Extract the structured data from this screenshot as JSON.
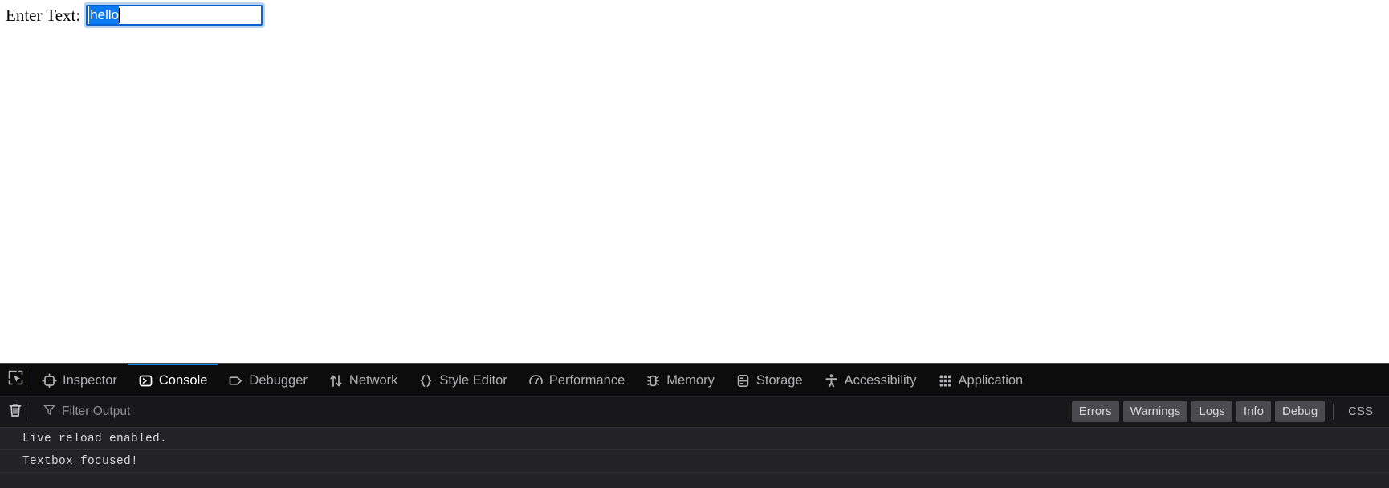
{
  "page": {
    "field_label": "Enter Text:",
    "input_value": "hello",
    "input_placeholder": "",
    "selection_color": "#0a7bf5",
    "focus_ring_color": "#0a62d0"
  },
  "devtools": {
    "accent_color": "#0a84ff",
    "picker_icon": "element-picker-icon",
    "tabs": [
      {
        "label": "Inspector",
        "icon": "inspector-icon",
        "active": false
      },
      {
        "label": "Console",
        "icon": "console-icon",
        "active": true
      },
      {
        "label": "Debugger",
        "icon": "debugger-icon",
        "active": false
      },
      {
        "label": "Network",
        "icon": "network-icon",
        "active": false
      },
      {
        "label": "Style Editor",
        "icon": "style-editor-icon",
        "active": false
      },
      {
        "label": "Performance",
        "icon": "performance-icon",
        "active": false
      },
      {
        "label": "Memory",
        "icon": "memory-icon",
        "active": false
      },
      {
        "label": "Storage",
        "icon": "storage-icon",
        "active": false
      },
      {
        "label": "Accessibility",
        "icon": "accessibility-icon",
        "active": false
      },
      {
        "label": "Application",
        "icon": "application-icon",
        "active": false
      }
    ],
    "filter_bar": {
      "clear_icon": "trash-icon",
      "filter_icon": "funnel-icon",
      "filter_value": "",
      "filter_placeholder": "Filter Output",
      "buttons": [
        {
          "label": "Errors",
          "active": true
        },
        {
          "label": "Warnings",
          "active": true
        },
        {
          "label": "Logs",
          "active": true
        },
        {
          "label": "Info",
          "active": true
        },
        {
          "label": "Debug",
          "active": true
        }
      ],
      "css_button": "CSS"
    },
    "console_messages": [
      {
        "text": "Live reload enabled."
      },
      {
        "text": "Textbox focused!"
      }
    ]
  }
}
